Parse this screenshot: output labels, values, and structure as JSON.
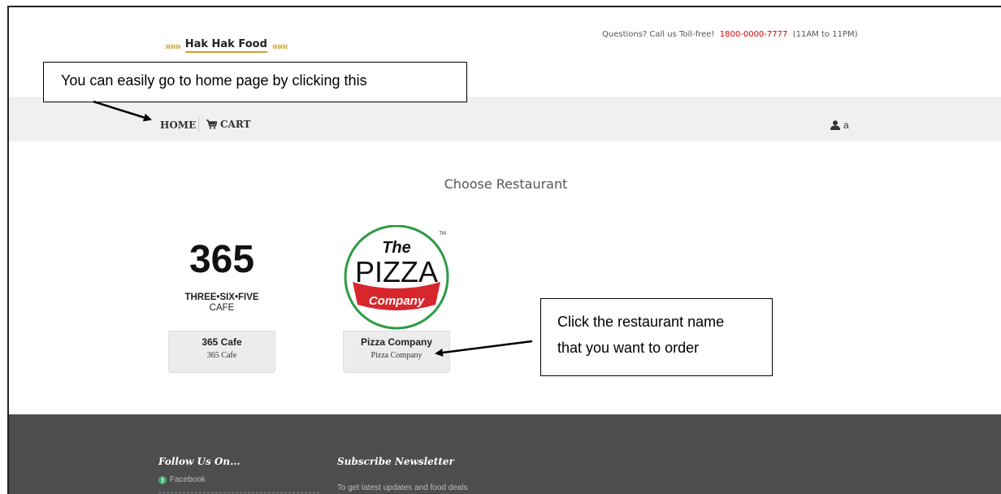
{
  "header": {
    "logo_text": "Hak Hak Food",
    "contact_prefix": "Questions? Call us Toll-free!",
    "phone": "1800-0000-7777",
    "hours": "(11AM to 11PM)"
  },
  "nav": {
    "home": "HOME",
    "cart": "CART",
    "user": "a"
  },
  "annotations": {
    "home_hint": "You can easily go to home page by clicking this",
    "restaurant_hint_line1": "Click the restaurant name",
    "restaurant_hint_line2": "that you want to order"
  },
  "main": {
    "title": "Choose Restaurant",
    "restaurants": [
      {
        "name": "365 Cafe",
        "subtitle": "365 Cafe",
        "logo": {
          "number": "365",
          "line1": "THREE•SIX•FIVE",
          "line2": "CAFE"
        }
      },
      {
        "name": "Pizza Company",
        "subtitle": "Pizza Company",
        "logo": {
          "the": "The",
          "word": "PIZZA",
          "tag": "Company",
          "tm": "TM"
        }
      }
    ]
  },
  "footer": {
    "follow_heading": "Follow Us On...",
    "facebook": "Facebook",
    "newsletter_heading": "Subscribe Newsletter",
    "newsletter_text": "To get latest updates and food deals"
  },
  "colors": {
    "navbar_bg": "#f0f0f0",
    "footer_bg": "#4d4d4d",
    "phone": "#dd0000",
    "pizza_red": "#d7262c",
    "pizza_green": "#2e9b45",
    "facebook_green": "#3cb371"
  }
}
